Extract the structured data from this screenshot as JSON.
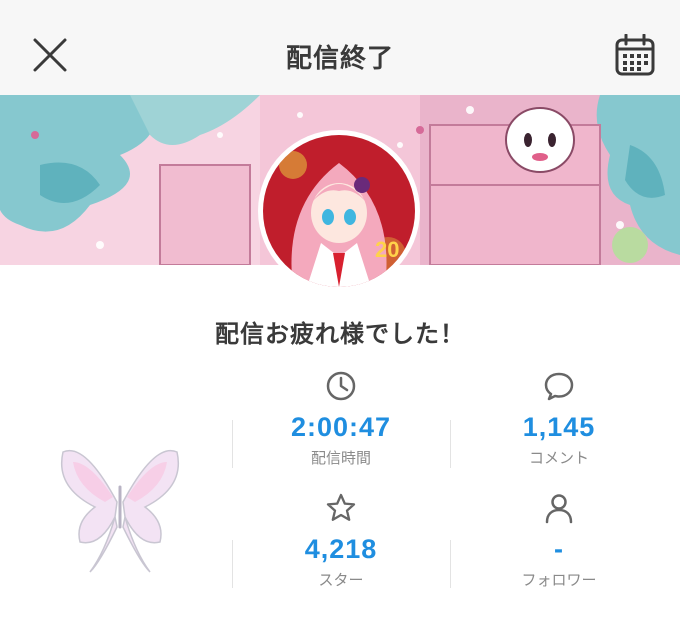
{
  "header": {
    "title": "配信終了",
    "close_icon": "close-icon",
    "calendar_icon": "calendar-icon"
  },
  "banner": {
    "image": "stream-banner-illustration"
  },
  "avatar": {
    "image": "streamer-avatar"
  },
  "message": "配信お疲れ様でした！",
  "stats": [
    {
      "icon": "clock-icon",
      "value": "2:00:47",
      "label": "配信時間"
    },
    {
      "icon": "comment-icon",
      "value": "1,145",
      "label": "コメント"
    },
    {
      "icon": "star-icon",
      "value": "4,218",
      "label": "スター"
    },
    {
      "icon": "person-icon",
      "value": "-",
      "label": "フォロワー"
    }
  ],
  "colors": {
    "accent": "#1f8ee0",
    "header_bg": "#f7f7f7",
    "label": "#8a8a8a"
  }
}
